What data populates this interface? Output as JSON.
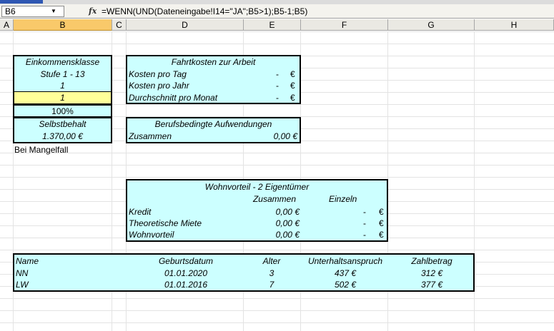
{
  "formula_bar": {
    "name_box": "B6",
    "fx_label": "fx",
    "formula": "=WENN(UND(Dateneingabe!I14=\"JA\";B5>1);B5-1;B5)"
  },
  "columns": [
    "A",
    "B",
    "C",
    "D",
    "E",
    "F",
    "G",
    "H"
  ],
  "selected_column": "B",
  "income_box": {
    "title": "Einkommensklasse",
    "stufe": "Stufe 1 - 13",
    "value1": "1",
    "value2": "1",
    "percent": "100%",
    "selbstbehalt_label": "Selbstbehalt",
    "selbstbehalt_value": "1.370,00 €",
    "mangelfall": "Bei Mangelfall"
  },
  "fahrt_box": {
    "title": "Fahrtkosten zur Arbeit",
    "rows": [
      {
        "label": "Kosten pro Tag",
        "dash": "-",
        "cur": "€"
      },
      {
        "label": "Kosten pro Jahr",
        "dash": "-",
        "cur": "€"
      },
      {
        "label": "Durchschnitt pro Monat",
        "dash": "-",
        "cur": "€"
      }
    ]
  },
  "beruf_box": {
    "title": "Berufsbedingte Aufwendungen",
    "label": "Zusammen",
    "value": "0,00 €"
  },
  "wohn_box": {
    "title": "Wohnvorteil - 2 Eigentümer",
    "col_zusammen": "Zusammen",
    "col_einzeln": "Einzeln",
    "rows": [
      {
        "label": "Kredit",
        "zusammen": "0,00 €",
        "dash": "-",
        "cur": "€"
      },
      {
        "label": "Theoretische Miete",
        "zusammen": "0,00 €",
        "dash": "-",
        "cur": "€"
      },
      {
        "label": "Wohnvorteil",
        "zusammen": "0,00 €",
        "dash": "-",
        "cur": "€"
      }
    ]
  },
  "kinder_table": {
    "headers": [
      "Name",
      "Geburtsdatum",
      "Alter",
      "Unterhaltsanspruch",
      "Zahlbetrag"
    ],
    "rows": [
      [
        "NN",
        "01.01.2020",
        "3",
        "437 €",
        "312 €"
      ],
      [
        "LW",
        "01.01.2016",
        "7",
        "502 €",
        "377 €"
      ]
    ]
  }
}
